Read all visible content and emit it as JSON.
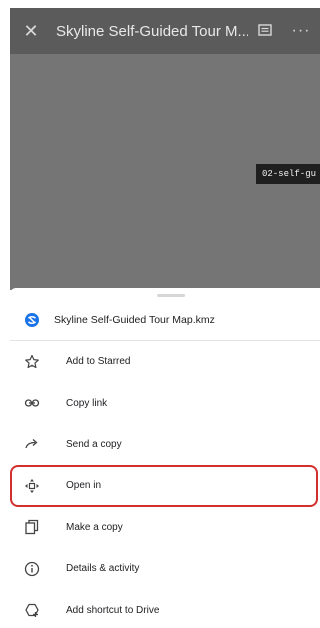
{
  "appbar": {
    "title": "Skyline Self-Guided Tour M...",
    "close_icon": "close-icon",
    "comment_icon": "comment-icon",
    "more_icon": "more-horizontal-icon"
  },
  "preview": {
    "file_chip": "02-self-gu"
  },
  "sheet": {
    "file_name": "Skyline Self-Guided Tour Map.kmz",
    "file_icon": "kmz-file-icon"
  },
  "menu": {
    "items": [
      {
        "label": "Add to Starred",
        "icon": "star-outline-icon"
      },
      {
        "label": "Copy link",
        "icon": "link-icon"
      },
      {
        "label": "Send a copy",
        "icon": "forward-arrow-icon"
      },
      {
        "label": "Open in",
        "icon": "open-in-move-icon",
        "highlighted": true
      },
      {
        "label": "Make a copy",
        "icon": "copy-icon"
      },
      {
        "label": "Details & activity",
        "icon": "info-icon"
      },
      {
        "label": "Add shortcut to Drive",
        "icon": "add-shortcut-icon"
      }
    ]
  },
  "colors": {
    "highlight_outline": "#d32f2f",
    "appbar_bg": "#5b5b5b",
    "preview_bg": "#757575"
  }
}
